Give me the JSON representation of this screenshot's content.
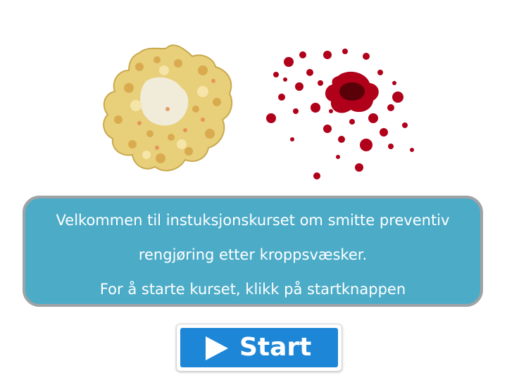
{
  "images": {
    "left": "vomit-image",
    "right": "blood-splatter-image"
  },
  "welcome": {
    "line1": "Velkommen til instuksjonskurset om smitte preventiv",
    "line2": "rengjøring etter kroppsvæsker.",
    "line3": "For å starte kurset, klikk på startknappen"
  },
  "start_button": {
    "label": "Start",
    "icon": "play-icon"
  },
  "colors": {
    "panel": "#4cacc8",
    "panel_border": "#9ea3a6",
    "button": "#1e86d6",
    "blood": "#b0001a",
    "vomit": "#e8cf7a"
  }
}
